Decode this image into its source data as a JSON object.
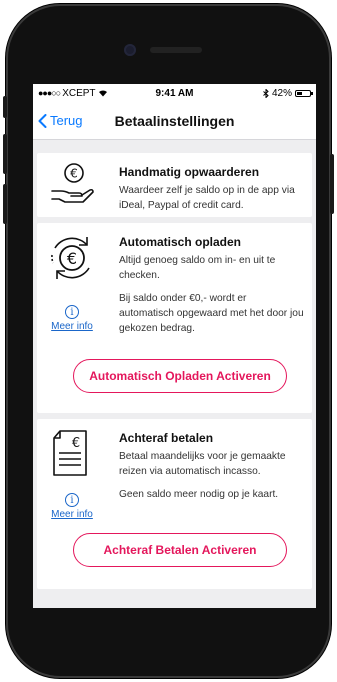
{
  "status_bar": {
    "carrier": "XCEPT",
    "time": "9:41 AM",
    "battery": "42%",
    "battery_level": 0.42,
    "icons": [
      "signal-dots-icon",
      "wifi-icon",
      "bluetooth-icon",
      "battery-icon"
    ]
  },
  "nav": {
    "back_label": "Terug",
    "title": "Betaalinstellingen"
  },
  "sections": {
    "manual": {
      "icon": "hand-euro-icon",
      "title": "Handmatig opwaarderen",
      "body": "Waardeer zelf je saldo op in de app via iDeal, Paypal of credit card."
    },
    "auto": {
      "icon": "euro-refresh-icon",
      "title": "Automatisch opladen",
      "body": "Altijd genoeg saldo om in- en uit te checken.",
      "detail": "Bij saldo onder €0,- wordt er automatisch opgewaard met het door jou gekozen bedrag.",
      "info_label": "Meer info",
      "button": "Automatisch Opladen Activeren"
    },
    "after": {
      "icon": "euro-document-icon",
      "title": "Achteraf betalen",
      "body": "Betaal maandelijks voor je gemaakte reizen via automatisch incasso.",
      "detail": "Geen saldo meer nodig op je kaart.",
      "info_label": "Meer info",
      "button": "Achteraf Betalen Activeren"
    }
  },
  "colors": {
    "accent": "#e4175c",
    "link": "#1a66c9",
    "ios_blue": "#0a7aff",
    "background": "#eeeef0"
  }
}
